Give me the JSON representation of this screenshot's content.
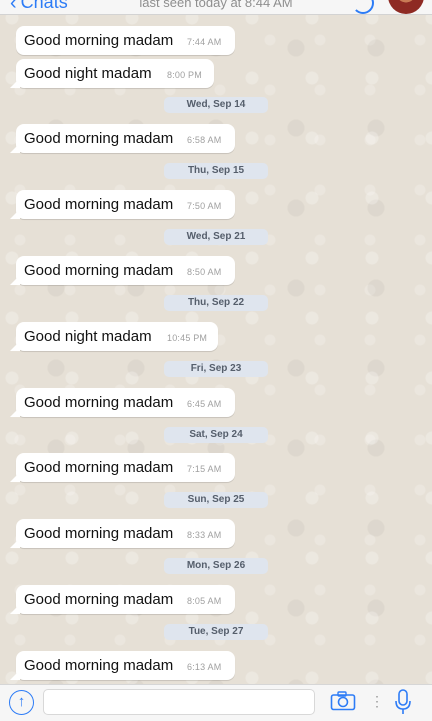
{
  "header": {
    "back_label": "Chats",
    "last_seen": "last seen today at 8:44 AM"
  },
  "messages": [
    {
      "text": "Good morning madam",
      "time": "7:44 AM"
    },
    {
      "text": "Good night madam",
      "time": "8:00 PM"
    },
    {
      "text": "Good morning madam",
      "time": "6:58 AM"
    },
    {
      "text": "Good morning madam",
      "time": "7:50 AM"
    },
    {
      "text": "Good morning madam",
      "time": "8:50 AM"
    },
    {
      "text": "Good night madam",
      "time": "10:45 PM"
    },
    {
      "text": "Good morning madam",
      "time": "6:45 AM"
    },
    {
      "text": "Good morning madam",
      "time": "7:15 AM"
    },
    {
      "text": "Good morning madam",
      "time": "8:33 AM"
    },
    {
      "text": "Good morning madam",
      "time": "8:05 AM"
    },
    {
      "text": "Good morning madam",
      "time": "6:13 AM"
    }
  ],
  "dates": [
    "Wed, Sep 14",
    "Thu, Sep 15",
    "Wed, Sep 21",
    "Thu, Sep 22",
    "Fri, Sep 23",
    "Sat, Sep 24",
    "Sun, Sep 25",
    "Mon, Sep 26",
    "Tue, Sep 27"
  ],
  "icons": {
    "back": "chevron-left-icon",
    "call": "phone-icon",
    "upload": "arrow-up-icon",
    "camera": "camera-icon",
    "more": "dots-icon",
    "mic": "microphone-icon"
  },
  "colors": {
    "accent": "#2d7cf6",
    "bubble": "#ffffff",
    "date_pill": "#dfe5ee",
    "wallpaper": "#e6e0d6"
  }
}
